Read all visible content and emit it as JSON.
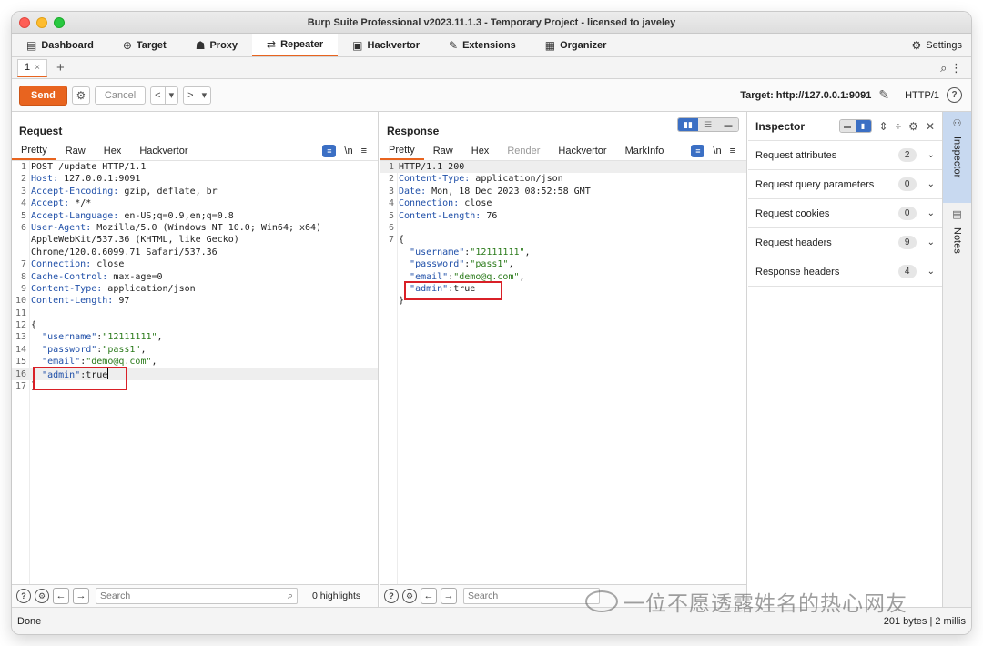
{
  "window": {
    "title": "Burp Suite Professional v2023.11.1.3 - Temporary Project - licensed to javeley"
  },
  "menu": {
    "dashboard": "Dashboard",
    "target": "Target",
    "proxy": "Proxy",
    "repeater": "Repeater",
    "hackvertor": "Hackvertor",
    "extensions": "Extensions",
    "organizer": "Organizer",
    "settings": "Settings"
  },
  "tabs": {
    "tab1": "1",
    "close": "×",
    "add": "+"
  },
  "toolbar": {
    "send": "Send",
    "cancel": "Cancel",
    "target": "Target: http://127.0.0.1:9091",
    "http": "HTTP/1",
    "help": "?"
  },
  "request": {
    "title": "Request",
    "tabs": {
      "pretty": "Pretty",
      "raw": "Raw",
      "hex": "Hex",
      "hackvertor": "Hackvertor"
    },
    "newline": "\\n",
    "lines": [
      {
        "n": "1",
        "text": "POST /update HTTP/1.1"
      },
      {
        "n": "2",
        "k": "Host:",
        "v": " 127.0.0.1:9091"
      },
      {
        "n": "3",
        "k": "Accept-Encoding:",
        "v": " gzip, deflate, br"
      },
      {
        "n": "4",
        "k": "Accept:",
        "v": " */*"
      },
      {
        "n": "5",
        "k": "Accept-Language:",
        "v": " en-US;q=0.9,en;q=0.8"
      },
      {
        "n": "6",
        "k": "User-Agent:",
        "v": " Mozilla/5.0 (Windows NT 10.0; Win64; x64)"
      },
      {
        "n": "",
        "text": "AppleWebKit/537.36 (KHTML, like Gecko)"
      },
      {
        "n": "",
        "text": "Chrome/120.0.6099.71 Safari/537.36"
      },
      {
        "n": "7",
        "k": "Connection:",
        "v": " close"
      },
      {
        "n": "8",
        "k": "Cache-Control:",
        "v": " max-age=0"
      },
      {
        "n": "9",
        "k": "Content-Type:",
        "v": " application/json"
      },
      {
        "n": "10",
        "k": "Content-Length:",
        "v": " 97"
      },
      {
        "n": "11",
        "text": ""
      },
      {
        "n": "12",
        "text": "{"
      },
      {
        "n": "13",
        "jk": "\"username\"",
        "jv": "\"12111111\"",
        "tail": ","
      },
      {
        "n": "14",
        "jk": "\"password\"",
        "jv": "\"pass1\"",
        "tail": ","
      },
      {
        "n": "15",
        "jk": "\"email\"",
        "jv": "\"demo@q.com\"",
        "tail": ","
      },
      {
        "n": "16",
        "jk": "\"admin\"",
        "jv": "true",
        "tail": ""
      },
      {
        "n": "17",
        "text": "}"
      }
    ],
    "search_placeholder": "Search",
    "highlights": "0 highlights"
  },
  "response": {
    "title": "Response",
    "tabs": {
      "pretty": "Pretty",
      "raw": "Raw",
      "hex": "Hex",
      "render": "Render",
      "hackvertor": "Hackvertor",
      "markinfo": "MarkInfo"
    },
    "newline": "\\n",
    "lines": [
      {
        "n": "1",
        "text": "HTTP/1.1 200"
      },
      {
        "n": "2",
        "k": "Content-Type:",
        "v": " application/json"
      },
      {
        "n": "3",
        "k": "Date:",
        "v": " Mon, 18 Dec 2023 08:52:58 GMT"
      },
      {
        "n": "4",
        "k": "Connection:",
        "v": " close"
      },
      {
        "n": "5",
        "k": "Content-Length:",
        "v": " 76"
      },
      {
        "n": "6",
        "text": ""
      },
      {
        "n": "7",
        "text": "{"
      },
      {
        "n": "",
        "jk": "\"username\"",
        "jv": "\"12111111\"",
        "tail": ","
      },
      {
        "n": "",
        "jk": "\"password\"",
        "jv": "\"pass1\"",
        "tail": ","
      },
      {
        "n": "",
        "jk": "\"email\"",
        "jv": "\"demo@q.com\"",
        "tail": ","
      },
      {
        "n": "",
        "jk": "\"admin\"",
        "jv": "true",
        "tail": ""
      },
      {
        "n": "",
        "text": "}"
      }
    ],
    "search_placeholder": "Search"
  },
  "inspector": {
    "title": "Inspector",
    "rows": [
      {
        "label": "Request attributes",
        "count": "2"
      },
      {
        "label": "Request query parameters",
        "count": "0"
      },
      {
        "label": "Request cookies",
        "count": "0"
      },
      {
        "label": "Request headers",
        "count": "9"
      },
      {
        "label": "Response headers",
        "count": "4"
      }
    ]
  },
  "sidebar": {
    "inspector": "Inspector",
    "notes": "Notes"
  },
  "status": {
    "left": "Done",
    "right": "201 bytes | 2 millis"
  },
  "watermark": {
    "text": "一位不愿透露姓名的热心网友"
  },
  "colors": {
    "accent": "#e8641f",
    "key": "#1f4fa8",
    "string": "#2a7a1a",
    "highlight_box": "#d92027"
  }
}
